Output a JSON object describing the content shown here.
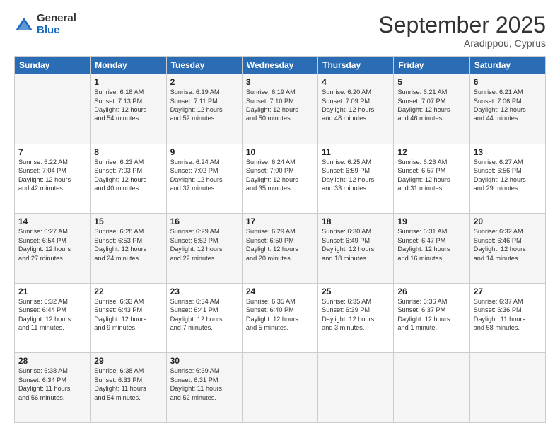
{
  "logo": {
    "general": "General",
    "blue": "Blue"
  },
  "title": "September 2025",
  "subtitle": "Aradippou, Cyprus",
  "headers": [
    "Sunday",
    "Monday",
    "Tuesday",
    "Wednesday",
    "Thursday",
    "Friday",
    "Saturday"
  ],
  "weeks": [
    [
      {
        "day": "",
        "info": ""
      },
      {
        "day": "1",
        "info": "Sunrise: 6:18 AM\nSunset: 7:13 PM\nDaylight: 12 hours\nand 54 minutes."
      },
      {
        "day": "2",
        "info": "Sunrise: 6:19 AM\nSunset: 7:11 PM\nDaylight: 12 hours\nand 52 minutes."
      },
      {
        "day": "3",
        "info": "Sunrise: 6:19 AM\nSunset: 7:10 PM\nDaylight: 12 hours\nand 50 minutes."
      },
      {
        "day": "4",
        "info": "Sunrise: 6:20 AM\nSunset: 7:09 PM\nDaylight: 12 hours\nand 48 minutes."
      },
      {
        "day": "5",
        "info": "Sunrise: 6:21 AM\nSunset: 7:07 PM\nDaylight: 12 hours\nand 46 minutes."
      },
      {
        "day": "6",
        "info": "Sunrise: 6:21 AM\nSunset: 7:06 PM\nDaylight: 12 hours\nand 44 minutes."
      }
    ],
    [
      {
        "day": "7",
        "info": "Sunrise: 6:22 AM\nSunset: 7:04 PM\nDaylight: 12 hours\nand 42 minutes."
      },
      {
        "day": "8",
        "info": "Sunrise: 6:23 AM\nSunset: 7:03 PM\nDaylight: 12 hours\nand 40 minutes."
      },
      {
        "day": "9",
        "info": "Sunrise: 6:24 AM\nSunset: 7:02 PM\nDaylight: 12 hours\nand 37 minutes."
      },
      {
        "day": "10",
        "info": "Sunrise: 6:24 AM\nSunset: 7:00 PM\nDaylight: 12 hours\nand 35 minutes."
      },
      {
        "day": "11",
        "info": "Sunrise: 6:25 AM\nSunset: 6:59 PM\nDaylight: 12 hours\nand 33 minutes."
      },
      {
        "day": "12",
        "info": "Sunrise: 6:26 AM\nSunset: 6:57 PM\nDaylight: 12 hours\nand 31 minutes."
      },
      {
        "day": "13",
        "info": "Sunrise: 6:27 AM\nSunset: 6:56 PM\nDaylight: 12 hours\nand 29 minutes."
      }
    ],
    [
      {
        "day": "14",
        "info": "Sunrise: 6:27 AM\nSunset: 6:54 PM\nDaylight: 12 hours\nand 27 minutes."
      },
      {
        "day": "15",
        "info": "Sunrise: 6:28 AM\nSunset: 6:53 PM\nDaylight: 12 hours\nand 24 minutes."
      },
      {
        "day": "16",
        "info": "Sunrise: 6:29 AM\nSunset: 6:52 PM\nDaylight: 12 hours\nand 22 minutes."
      },
      {
        "day": "17",
        "info": "Sunrise: 6:29 AM\nSunset: 6:50 PM\nDaylight: 12 hours\nand 20 minutes."
      },
      {
        "day": "18",
        "info": "Sunrise: 6:30 AM\nSunset: 6:49 PM\nDaylight: 12 hours\nand 18 minutes."
      },
      {
        "day": "19",
        "info": "Sunrise: 6:31 AM\nSunset: 6:47 PM\nDaylight: 12 hours\nand 16 minutes."
      },
      {
        "day": "20",
        "info": "Sunrise: 6:32 AM\nSunset: 6:46 PM\nDaylight: 12 hours\nand 14 minutes."
      }
    ],
    [
      {
        "day": "21",
        "info": "Sunrise: 6:32 AM\nSunset: 6:44 PM\nDaylight: 12 hours\nand 11 minutes."
      },
      {
        "day": "22",
        "info": "Sunrise: 6:33 AM\nSunset: 6:43 PM\nDaylight: 12 hours\nand 9 minutes."
      },
      {
        "day": "23",
        "info": "Sunrise: 6:34 AM\nSunset: 6:41 PM\nDaylight: 12 hours\nand 7 minutes."
      },
      {
        "day": "24",
        "info": "Sunrise: 6:35 AM\nSunset: 6:40 PM\nDaylight: 12 hours\nand 5 minutes."
      },
      {
        "day": "25",
        "info": "Sunrise: 6:35 AM\nSunset: 6:39 PM\nDaylight: 12 hours\nand 3 minutes."
      },
      {
        "day": "26",
        "info": "Sunrise: 6:36 AM\nSunset: 6:37 PM\nDaylight: 12 hours\nand 1 minute."
      },
      {
        "day": "27",
        "info": "Sunrise: 6:37 AM\nSunset: 6:36 PM\nDaylight: 11 hours\nand 58 minutes."
      }
    ],
    [
      {
        "day": "28",
        "info": "Sunrise: 6:38 AM\nSunset: 6:34 PM\nDaylight: 11 hours\nand 56 minutes."
      },
      {
        "day": "29",
        "info": "Sunrise: 6:38 AM\nSunset: 6:33 PM\nDaylight: 11 hours\nand 54 minutes."
      },
      {
        "day": "30",
        "info": "Sunrise: 6:39 AM\nSunset: 6:31 PM\nDaylight: 11 hours\nand 52 minutes."
      },
      {
        "day": "",
        "info": ""
      },
      {
        "day": "",
        "info": ""
      },
      {
        "day": "",
        "info": ""
      },
      {
        "day": "",
        "info": ""
      }
    ]
  ]
}
